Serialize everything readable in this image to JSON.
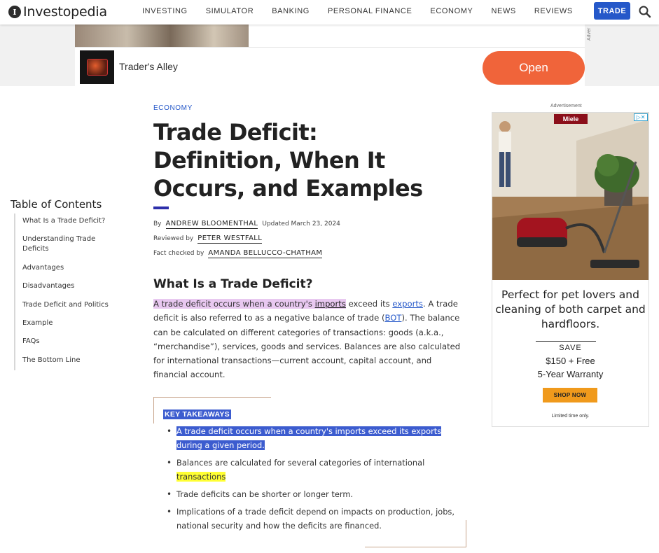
{
  "nav": {
    "logo_mark": "I",
    "logo_text": "Investopedia",
    "links": [
      "INVESTING",
      "SIMULATOR",
      "BANKING",
      "PERSONAL FINANCE",
      "ECONOMY",
      "NEWS",
      "REVIEWS"
    ],
    "trade_label": "TRADE"
  },
  "top_ad": {
    "side_label": "Adver",
    "advertiser": "Trader's Alley",
    "cta": "Open",
    "cta_color": "#f0643a"
  },
  "toc": {
    "title": "Table of Contents",
    "items": [
      "What Is a Trade Deficit?",
      "Understanding Trade Deficits",
      "Advantages",
      "Disadvantages",
      "Trade Deficit and Politics",
      "Example",
      "FAQs",
      "The Bottom Line"
    ]
  },
  "article": {
    "category": "ECONOMY",
    "title": "Trade Deficit: Definition, When It Occurs, and Examples",
    "byline": {
      "by_label": "By",
      "author": "ANDREW BLOOMENTHAL",
      "updated": "Updated March 23, 2024",
      "reviewed_label": "Reviewed by",
      "reviewer": "PETER WESTFALL",
      "factcheck_label": "Fact checked by",
      "factchecker": "AMANDA BELLUCCO-CHATHAM"
    },
    "section_heading": "What Is a Trade Deficit?",
    "para": {
      "p1": "A trade deficit occurs when a country's ",
      "link_imports": "imports",
      "p2": " exceed its ",
      "link_exports": "exports",
      "p3": ". A trade deficit is also referred to as a negative balance of trade (",
      "link_bot": "BOT",
      "p4": "). The balance can be calculated on different categories of transactions: goods (a.k.a., “merchandise”), services, goods and services. Balances are also calculated for international transactions—current account, capital account, and financial account."
    },
    "key_takeaways": {
      "title": "KEY TAKEAWAYS",
      "items": [
        "A trade deficit occurs when a country's imports exceed its exports during a given period.",
        "Balances are calculated for several categories of international ",
        "transactions",
        "Trade deficits can be shorter or longer term.",
        "Implications of a trade deficit depend on impacts on production, jobs, national security and how the deficits are financed."
      ]
    }
  },
  "right_ad": {
    "label": "Advertisement",
    "brand": "Miele",
    "adchoice": "▷✕",
    "copy": "Perfect for pet lovers and cleaning of both carpet and hardfloors.",
    "save": "SAVE",
    "offer1": "$150 + Free",
    "offer2": "5-Year Warranty",
    "cta": "SHOP NOW",
    "limited": "Limited time only.",
    "cta_color": "#f09a1c"
  },
  "colors": {
    "accent": "#2558c9",
    "selection": "#3c5ccf",
    "highlight_purple": "#e8c8f0",
    "highlight_yellow": "#ffff33"
  }
}
